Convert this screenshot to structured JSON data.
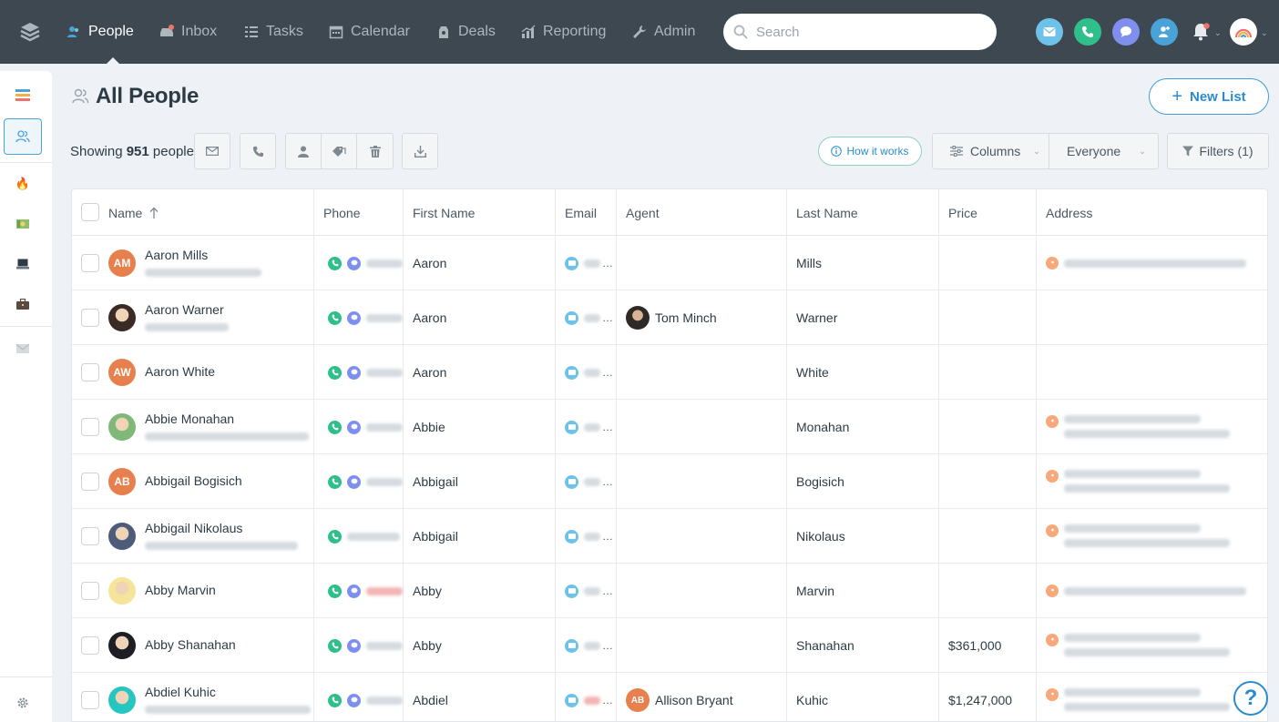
{
  "nav": {
    "items": [
      {
        "label": "People",
        "icon": "people-icon",
        "active": true
      },
      {
        "label": "Inbox",
        "icon": "inbox-icon",
        "active": false
      },
      {
        "label": "Tasks",
        "icon": "tasks-icon",
        "active": false
      },
      {
        "label": "Calendar",
        "icon": "calendar-icon",
        "active": false
      },
      {
        "label": "Deals",
        "icon": "deals-icon",
        "active": false
      },
      {
        "label": "Reporting",
        "icon": "reporting-icon",
        "active": false
      },
      {
        "label": "Admin",
        "icon": "wrench-icon",
        "active": false
      }
    ],
    "search_placeholder": "Search"
  },
  "page": {
    "title": "All People",
    "new_list_label": "New List",
    "showing_prefix": "Showing",
    "showing_count": "951",
    "showing_suffix": "people",
    "how_it_works": "How it works",
    "columns_label": "Columns",
    "everyone_label": "Everyone",
    "filters_label": "Filters (1)"
  },
  "colors": {
    "accent": "#2a8cd0",
    "nav_bg": "#3d4851",
    "phone_green": "#2fbf8a",
    "text_purple": "#7f8ff0"
  },
  "table": {
    "headers": [
      "Name",
      "Phone",
      "First Name",
      "Email",
      "Agent",
      "Last Name",
      "Price",
      "Address"
    ],
    "rows": [
      {
        "name": "Aaron Mills",
        "initials": "AM",
        "av": "#e8804d",
        "sub": true,
        "first": "Aaron",
        "agent": "",
        "agent_init": "",
        "last": "Mills",
        "price": "",
        "addr": 1,
        "phone_red": false,
        "email_red": false
      },
      {
        "name": "Aaron Warner",
        "initials": "",
        "av": "#3a2b25",
        "sub": true,
        "first": "Aaron",
        "agent": "Tom Minch",
        "agent_init": "",
        "last": "Warner",
        "price": "",
        "addr": 0,
        "phone_red": false,
        "email_red": false
      },
      {
        "name": "Aaron White",
        "initials": "AW",
        "av": "#e8804d",
        "sub": false,
        "first": "Aaron",
        "agent": "",
        "agent_init": "",
        "last": "White",
        "price": "",
        "addr": 0,
        "phone_red": false,
        "email_red": false
      },
      {
        "name": "Abbie Monahan",
        "initials": "",
        "av": "#7fb878",
        "sub": true,
        "first": "Abbie",
        "agent": "",
        "agent_init": "",
        "last": "Monahan",
        "price": "",
        "addr": 2,
        "phone_red": false,
        "email_red": false
      },
      {
        "name": "Abbigail Bogisich",
        "initials": "AB",
        "av": "#e8804d",
        "sub": false,
        "first": "Abbigail",
        "agent": "",
        "agent_init": "",
        "last": "Bogisich",
        "price": "",
        "addr": 2,
        "phone_red": false,
        "email_red": false
      },
      {
        "name": "Abbigail Nikolaus",
        "initials": "",
        "av": "#4d5c7a",
        "sub": true,
        "first": "Abbigail",
        "agent": "",
        "agent_init": "",
        "last": "Nikolaus",
        "price": "",
        "addr": 2,
        "phone_red": false,
        "email_red": false
      },
      {
        "name": "Abby Marvin",
        "initials": "",
        "av": "#f4e59a",
        "sub": false,
        "first": "Abby",
        "agent": "",
        "agent_init": "",
        "last": "Marvin",
        "price": "",
        "addr": 1,
        "phone_red": true,
        "email_red": false
      },
      {
        "name": "Abby Shanahan",
        "initials": "",
        "av": "#1d1f24",
        "sub": false,
        "first": "Abby",
        "agent": "",
        "agent_init": "",
        "last": "Shanahan",
        "price": "$361,000",
        "addr": 2,
        "phone_red": false,
        "email_red": false
      },
      {
        "name": "Abdiel Kuhic",
        "initials": "",
        "av": "#26c6c0",
        "sub": true,
        "first": "Abdiel",
        "agent": "Allison Bryant",
        "agent_init": "AB",
        "last": "Kuhic",
        "price": "$1,247,000",
        "addr": 2,
        "phone_red": false,
        "email_red": true
      }
    ]
  }
}
